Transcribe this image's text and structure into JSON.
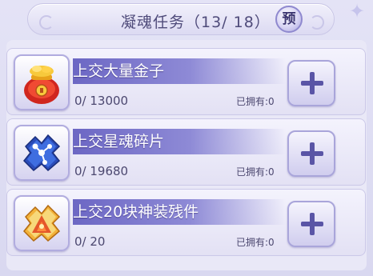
{
  "header": {
    "title": "凝魂任务（13/ 18）",
    "preview_label": "预"
  },
  "tasks": [
    {
      "name": "上交大量金子",
      "progress": "0/ 13000",
      "owned": "已拥有:0",
      "icon": "gold-bag-icon"
    },
    {
      "name": "上交星魂碎片",
      "progress": "0/ 19680",
      "owned": "已拥有:0",
      "icon": "star-soul-fragment-icon"
    },
    {
      "name": "上交20块神装残件",
      "progress": "0/ 20",
      "owned": "已拥有:0",
      "icon": "divine-gear-fragment-icon"
    }
  ],
  "colors": {
    "accent": "#6c67c4",
    "background": "#e4e3f6",
    "plus": "#5a55a6"
  }
}
